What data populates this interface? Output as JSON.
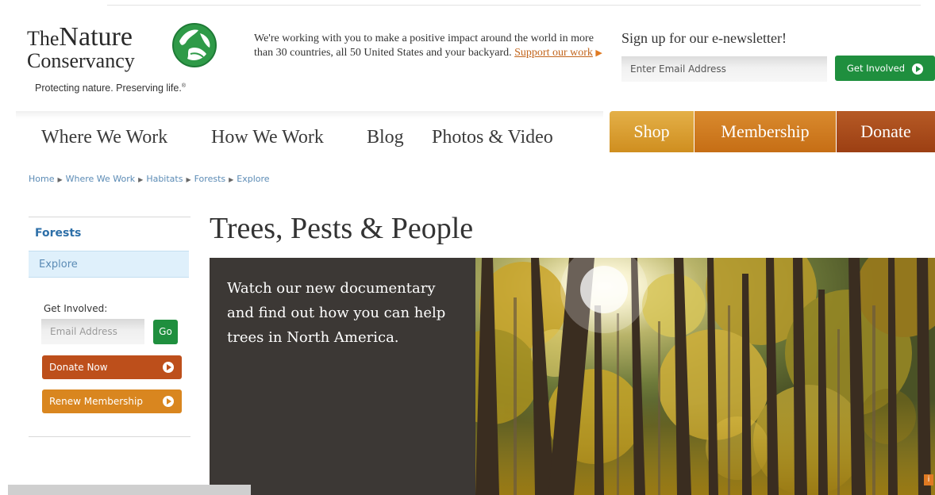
{
  "logo": {
    "the": "The",
    "nature": "Nature",
    "conservancy": "Conservancy",
    "tagline": "Protecting nature. Preserving life.",
    "tagline_mark": "®"
  },
  "intro": {
    "text": "We're working with you to make a positive impact around the world in more than 30 countries, all 50 United States and your backyard.",
    "link": "Support our work",
    "arrow": "▶"
  },
  "newsletter": {
    "title": "Sign up for our e-newsletter!",
    "placeholder": "Enter Email Address",
    "button": "Get Involved"
  },
  "nav": {
    "items": [
      "Where We Work",
      "How We Work",
      "Blog",
      "Photos & Video"
    ],
    "tabs": [
      "Shop",
      "Membership",
      "Donate"
    ]
  },
  "breadcrumb": {
    "items": [
      "Home",
      "Where We Work",
      "Habitats",
      "Forests",
      "Explore"
    ],
    "separator": "▶"
  },
  "sidebar": {
    "heading": "Forests",
    "items": [
      "Explore"
    ],
    "get_involved_label": "Get Involved:",
    "email_placeholder": "Email Address",
    "go": "Go",
    "donate": "Donate Now",
    "renew": "Renew Membership"
  },
  "main": {
    "title": "Trees, Pests & People",
    "hero_text": "Watch our new documentary and find out how you can help trees in North America."
  },
  "colors": {
    "green": "#1f8f3e",
    "shop": "#d89a2c",
    "membership": "#cf7a1f",
    "donate": "#a8471a",
    "link_blue": "#5b8bb5",
    "hero_panel": "#3c3835"
  }
}
